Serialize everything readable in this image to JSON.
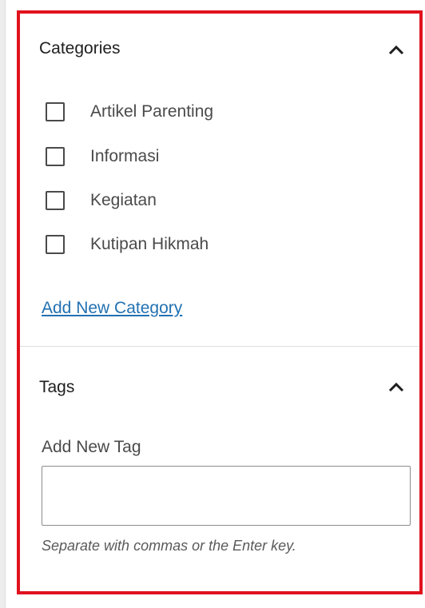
{
  "categories_panel": {
    "title": "Categories",
    "items": [
      {
        "label": "Artikel Parenting",
        "checked": false
      },
      {
        "label": "Informasi",
        "checked": false
      },
      {
        "label": "Kegiatan",
        "checked": false
      },
      {
        "label": "Kutipan Hikmah",
        "checked": false
      }
    ],
    "add_link": "Add New Category"
  },
  "tags_panel": {
    "title": "Tags",
    "field_label": "Add New Tag",
    "input_value": "",
    "help_text": "Separate with commas or the Enter key."
  },
  "colors": {
    "highlight": "#e0121e",
    "link": "#2271b1"
  }
}
